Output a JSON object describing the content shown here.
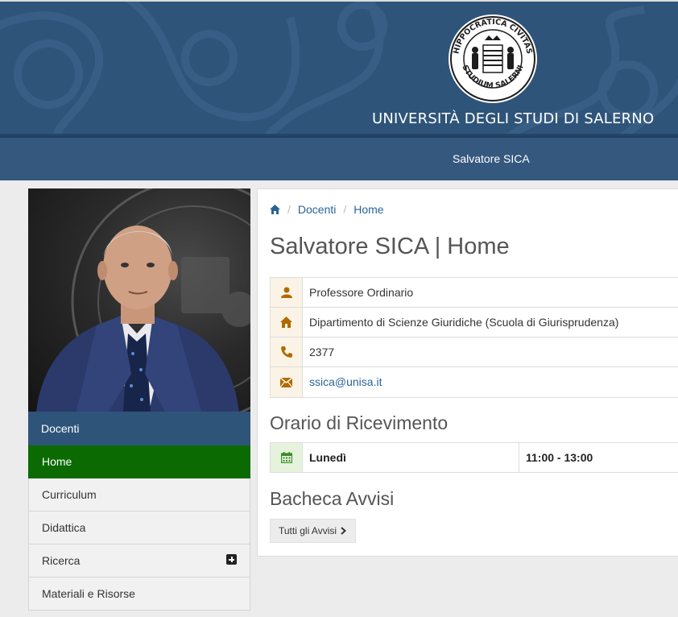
{
  "header": {
    "university_name": "UNIVERSITÀ DEGLI STUDI DI SALERNO",
    "seal_text_top": "HIPPOCRATICA CIVITAS",
    "seal_text_bottom": "STUDIUM SALERNI",
    "person_name": "Salvatore SICA"
  },
  "breadcrumb": {
    "home_icon": "home-icon",
    "items": [
      "Docenti",
      "Home"
    ]
  },
  "page": {
    "title": "Salvatore SICA | Home"
  },
  "info": [
    {
      "icon": "user-icon",
      "text": "Professore Ordinario"
    },
    {
      "icon": "home-icon",
      "text": "Dipartimento di Scienze Giuridiche (Scuola di Giurisprudenza)"
    },
    {
      "icon": "phone-icon",
      "text": "2377"
    },
    {
      "icon": "envelope-icon",
      "text": "ssica@unisa.it"
    }
  ],
  "office_hours": {
    "title": "Orario di Ricevimento",
    "rows": [
      {
        "icon": "calendar-icon",
        "day": "Lunedì",
        "time": "11:00 - 13:00"
      }
    ]
  },
  "notices": {
    "title": "Bacheca Avvisi",
    "button_label": "Tutti gli Avvisi"
  },
  "sidebar": {
    "heading": "Docenti",
    "items": [
      {
        "label": "Home",
        "active": true
      },
      {
        "label": "Curriculum"
      },
      {
        "label": "Didattica"
      },
      {
        "label": "Ricerca",
        "expandable": true
      },
      {
        "label": "Materiali e Risorse"
      }
    ]
  },
  "colors": {
    "header_blue": "#2f5479",
    "active_green": "#0b6a02",
    "icon_orange": "#b06a00",
    "link_blue": "#2a6496"
  }
}
